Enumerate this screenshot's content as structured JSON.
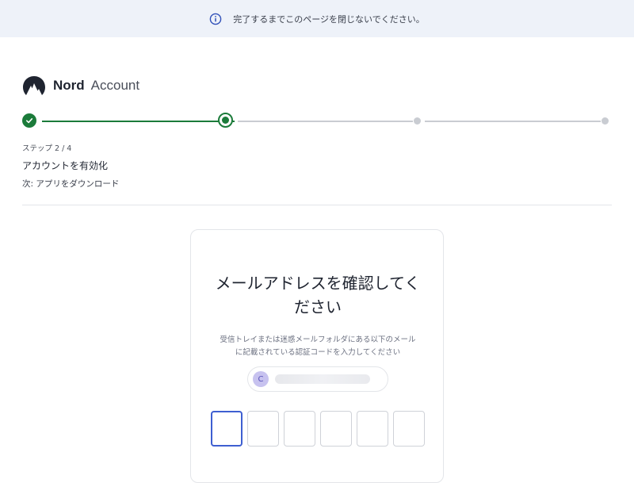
{
  "banner": {
    "icon": "info-circle-icon",
    "text": "完了するまでこのページを閉じないでください。"
  },
  "header": {
    "logo_icon": "nord-mountain-icon",
    "brand": "Nord",
    "product": "Account"
  },
  "stepper": {
    "steps": [
      {
        "state": "done"
      },
      {
        "state": "current"
      },
      {
        "state": "todo"
      },
      {
        "state": "todo"
      }
    ],
    "accent_color": "#1b7b3a",
    "inactive_color": "#c9ccd2"
  },
  "step_info": {
    "label": "ステップ 2 / 4",
    "title": "アカウントを有効化",
    "next": "次: アプリをダウンロード"
  },
  "verify_card": {
    "title_lines": [
      "メールアドレスを確認してく",
      "ださい"
    ],
    "description_lines": [
      "受信トレイまたは迷惑メールフォルダにある以下のメール",
      "に記載されている認証コードを入力してください"
    ],
    "email_avatar_initial": "C",
    "code_boxes": [
      "",
      "",
      "",
      "",
      "",
      ""
    ],
    "active_box_color": "#3e5fd1"
  }
}
